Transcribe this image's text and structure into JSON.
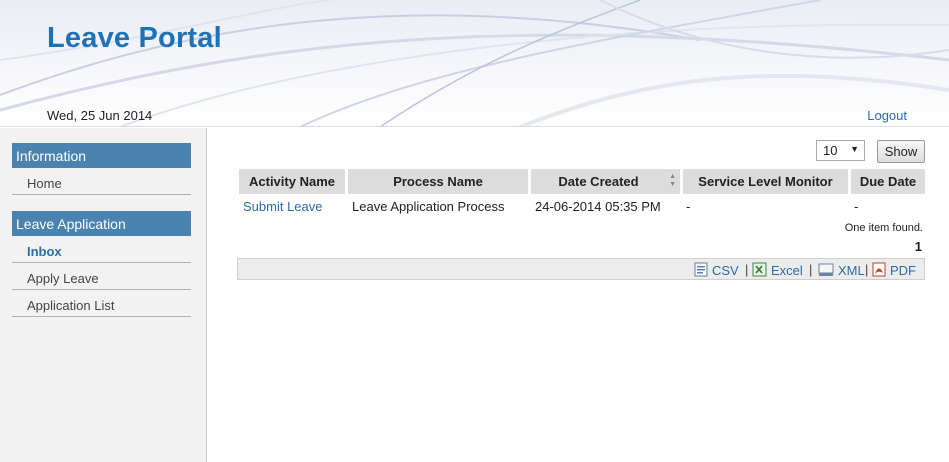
{
  "header": {
    "title": "Leave Portal",
    "date": "Wed, 25 Jun 2014",
    "logout_label": "Logout"
  },
  "sidebar": {
    "sections": [
      {
        "title": "Information",
        "items": [
          {
            "label": "Home"
          }
        ]
      },
      {
        "title": "Leave Application",
        "items": [
          {
            "label": "Inbox",
            "active": true
          },
          {
            "label": "Apply Leave"
          },
          {
            "label": "Application List"
          }
        ]
      }
    ]
  },
  "toolbar": {
    "page_size": "10",
    "show_label": "Show"
  },
  "table": {
    "columns": [
      "Activity Name",
      "Process Name",
      "Date Created",
      "Service Level Monitor",
      "Due Date"
    ],
    "rows": [
      {
        "activity": "Submit Leave",
        "process": "Leave Application Process",
        "date_created": "24-06-2014 05:35 PM",
        "slm": "-",
        "due": "-"
      }
    ],
    "found_text": "One item found.",
    "page": "1"
  },
  "export": {
    "csv": "CSV",
    "excel": "Excel",
    "xml": "XML",
    "pdf": "PDF",
    "separator": "|"
  },
  "colors": {
    "accent": "#1d72b8",
    "section_header": "#4a82b0",
    "link": "#2c6aa8"
  }
}
